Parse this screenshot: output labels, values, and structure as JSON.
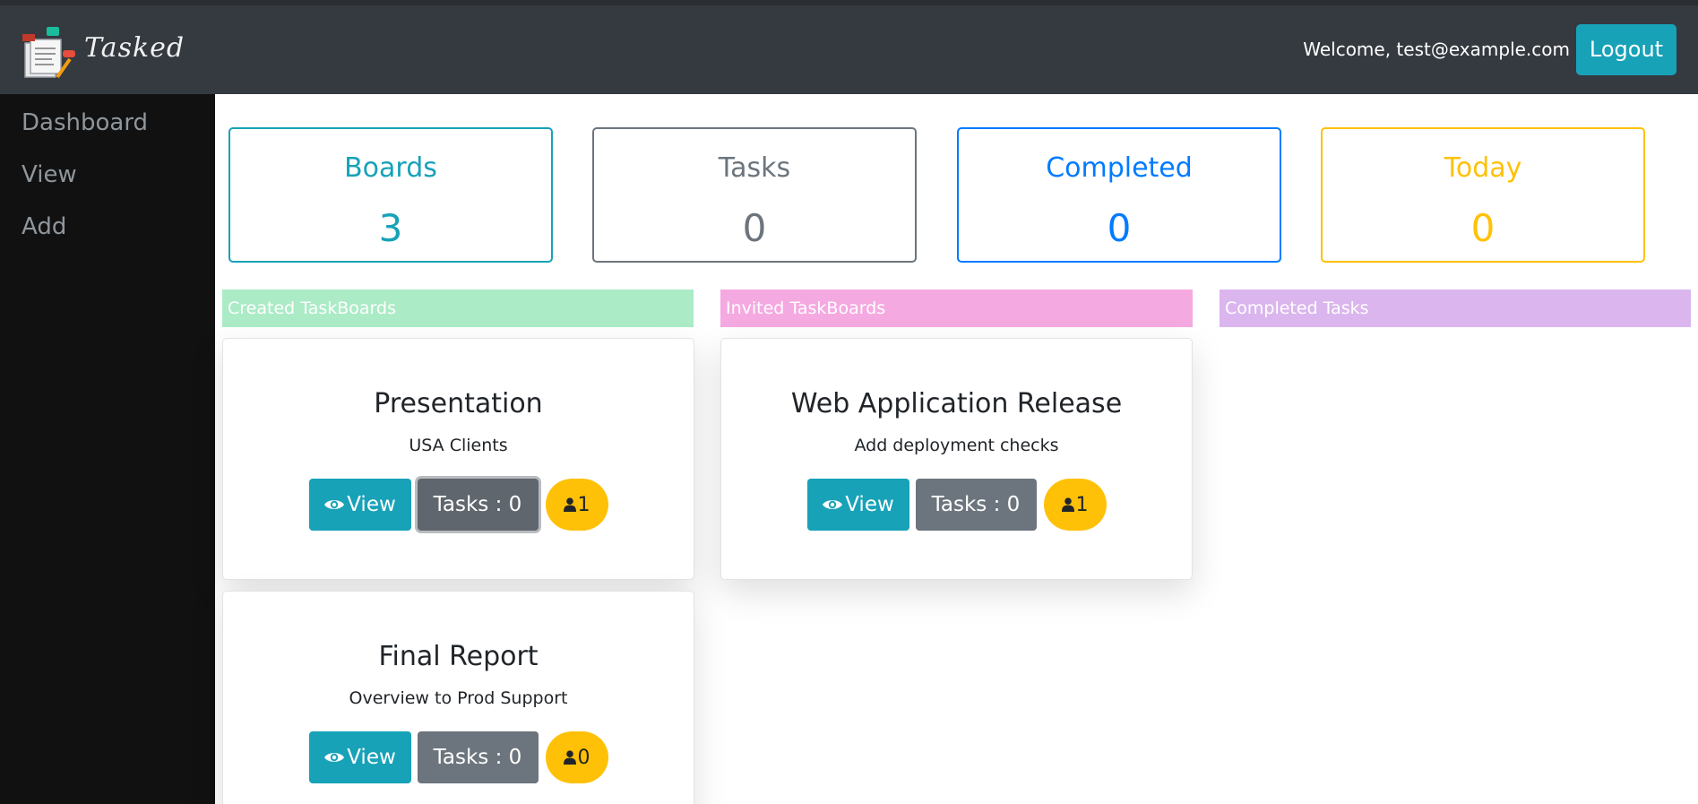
{
  "header": {
    "logo_text": "Tasked",
    "welcome": "Welcome, test@example.com",
    "logout_label": "Logout"
  },
  "sidebar": {
    "items": [
      {
        "label": "Dashboard"
      },
      {
        "label": "View"
      },
      {
        "label": "Add"
      }
    ]
  },
  "stats": [
    {
      "label": "Boards",
      "value": "3",
      "color": "#17a2b8"
    },
    {
      "label": "Tasks",
      "value": "0",
      "color": "#6c757d"
    },
    {
      "label": "Completed",
      "value": "0",
      "color": "#007bff"
    },
    {
      "label": "Today",
      "value": "0",
      "color": "#ffc107"
    }
  ],
  "sections": {
    "created": {
      "label": "Created TaskBoards",
      "color": "#abebc6"
    },
    "invited": {
      "label": "Invited TaskBoards",
      "color": "#f5a9e1"
    },
    "completed": {
      "label": "Completed Tasks",
      "color": "#dbb6ee"
    }
  },
  "boards": [
    {
      "title": "Presentation",
      "description": "USA Clients",
      "view_label": "View",
      "tasks_label": "Tasks : 0",
      "members": "1"
    },
    {
      "title": "Web Application Release",
      "description": "Add deployment checks",
      "view_label": "View",
      "tasks_label": "Tasks : 0",
      "members": "1"
    },
    {
      "title": "Final Report",
      "description": "Overview to Prod Support",
      "view_label": "View",
      "tasks_label": "Tasks : 0",
      "members": "0"
    }
  ],
  "icons": {
    "view": "eye-icon",
    "members": "user-icon"
  }
}
